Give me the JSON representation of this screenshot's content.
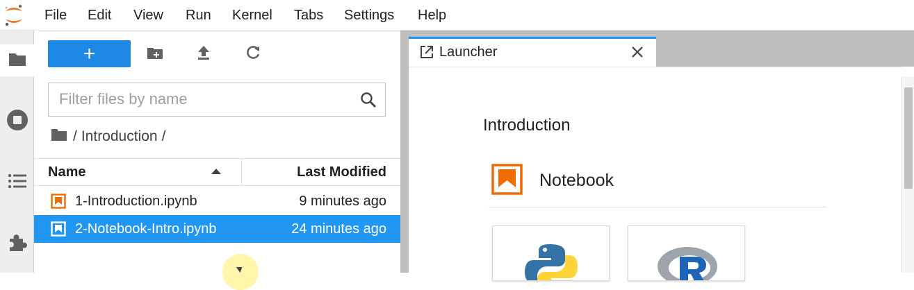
{
  "menubar": {
    "items": [
      "File",
      "Edit",
      "View",
      "Run",
      "Kernel",
      "Tabs",
      "Settings",
      "Help"
    ]
  },
  "activity_bar": {
    "icons": [
      "folder-icon",
      "stop-circle-icon",
      "list-icon",
      "puzzle-icon"
    ]
  },
  "filebrowser": {
    "new_label": "+",
    "filter_placeholder": "Filter files by name",
    "breadcrumb": {
      "root": "/",
      "folder": "Introduction",
      "trail": "/"
    },
    "columns": {
      "name": "Name",
      "modified": "Last Modified"
    },
    "files": [
      {
        "name": "1-Introduction.ipynb",
        "modified": "9 minutes ago",
        "selected": false
      },
      {
        "name": "2-Notebook-Intro.ipynb",
        "modified": "24 minutes ago",
        "selected": true
      }
    ]
  },
  "tab": {
    "label": "Launcher"
  },
  "launcher": {
    "section_title": "Introduction",
    "notebook_label": "Notebook",
    "kernels": [
      "python-logo-icon",
      "r-logo-icon"
    ]
  },
  "colors": {
    "accent": "#2196f3",
    "new_button": "#1e88e5",
    "notebook_orange": "#ef6c00"
  }
}
